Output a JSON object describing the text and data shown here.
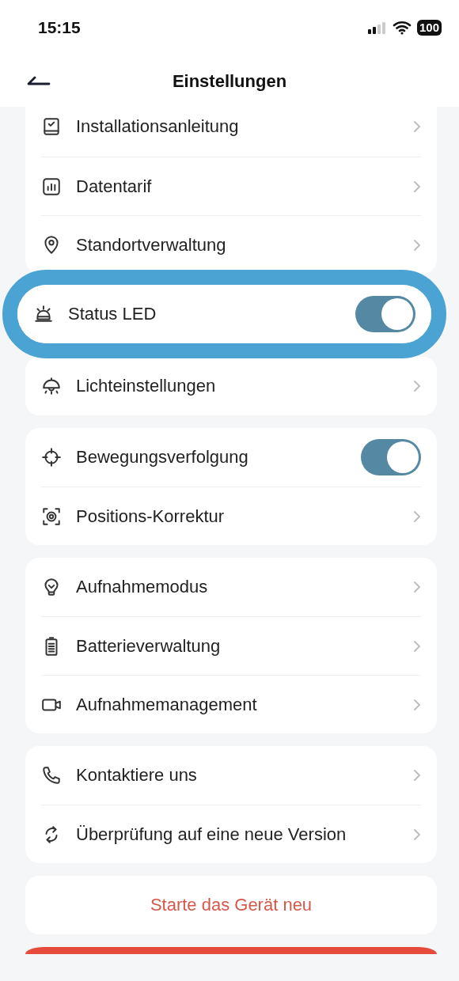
{
  "status_bar": {
    "time": "15:15",
    "battery": "100"
  },
  "header": {
    "title": "Einstellungen"
  },
  "cards": [
    {
      "highlighted": false,
      "clipped": true,
      "rows": [
        {
          "kind": "link",
          "label": "Installationsanleitung"
        },
        {
          "kind": "link",
          "label": "Datentarif"
        },
        {
          "kind": "link",
          "label": "Standortverwaltung"
        }
      ]
    },
    {
      "highlighted": true,
      "clipped": false,
      "rows": [
        {
          "kind": "toggle",
          "label": "Status LED",
          "on": true
        }
      ]
    },
    {
      "highlighted": false,
      "clipped": false,
      "rows": [
        {
          "kind": "link",
          "label": "Lichteinstellungen"
        }
      ]
    },
    {
      "highlighted": false,
      "clipped": false,
      "rows": [
        {
          "kind": "toggle",
          "label": "Bewegungsverfolgung",
          "on": true
        },
        {
          "kind": "link",
          "label": "Positions-Korrektur"
        }
      ]
    },
    {
      "highlighted": false,
      "clipped": false,
      "rows": [
        {
          "kind": "link",
          "label": "Aufnahmemodus"
        },
        {
          "kind": "link",
          "label": "Batterieverwaltung"
        },
        {
          "kind": "link",
          "label": "Aufnahmemanagement"
        }
      ]
    },
    {
      "highlighted": false,
      "clipped": false,
      "rows": [
        {
          "kind": "link",
          "label": "Kontaktiere uns"
        },
        {
          "kind": "link",
          "label": "Überprüfung auf eine neue Version"
        }
      ]
    }
  ],
  "restart_button": {
    "label": "Starte das Gerät neu"
  },
  "bottom_button": {
    "kind": "danger"
  }
}
